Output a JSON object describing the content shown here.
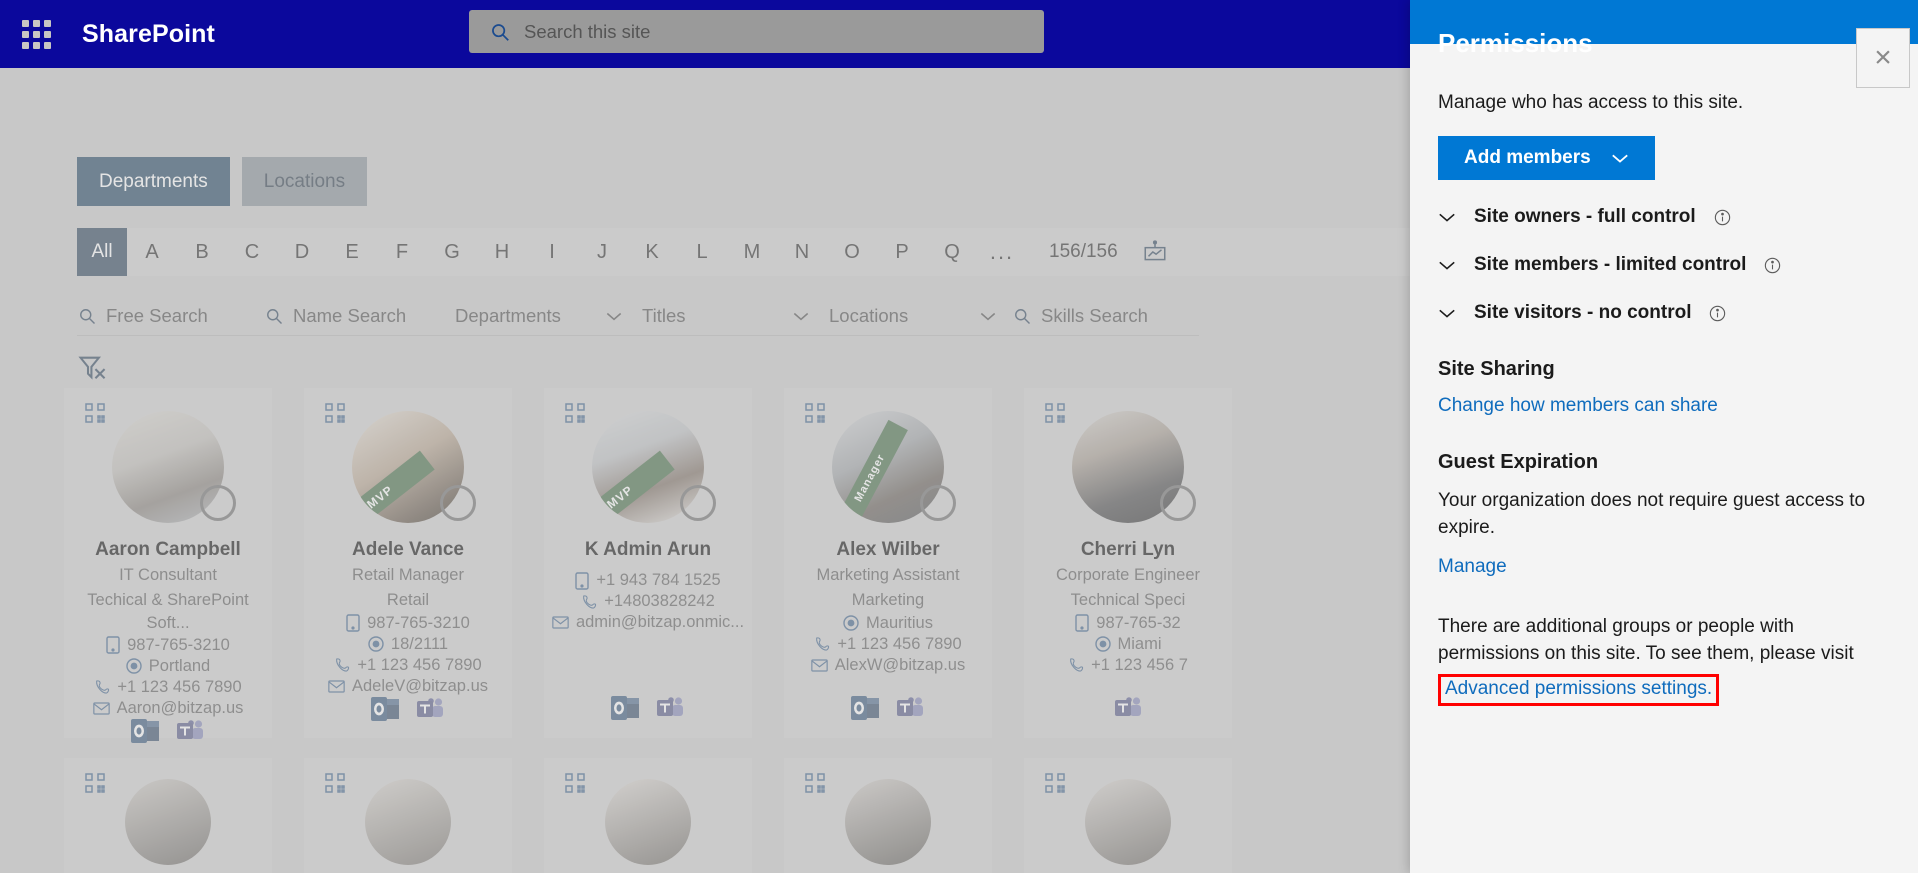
{
  "suite": {
    "waffle_icon": "app-launcher-waffle-icon",
    "brand": "SharePoint",
    "search": {
      "placeholder": "Search this site",
      "value": "",
      "icon": "search-icon"
    }
  },
  "page": {
    "tabs": [
      {
        "label": "Departments",
        "active": true
      },
      {
        "label": "Locations",
        "active": false
      }
    ],
    "alphabet": [
      "All",
      "A",
      "B",
      "C",
      "D",
      "E",
      "F",
      "G",
      "H",
      "I",
      "J",
      "K",
      "L",
      "M",
      "N",
      "O",
      "P",
      "Q",
      "..."
    ],
    "alphabet_active": "All",
    "count": "156/156",
    "presentation_icon": "presentation-chart-icon",
    "filters": [
      {
        "label": "Free Search",
        "type": "search",
        "icon": "search-icon"
      },
      {
        "label": "Name Search",
        "type": "search",
        "icon": "search-icon"
      },
      {
        "label": "Departments",
        "type": "dropdown",
        "icon": "chevron-down-icon"
      },
      {
        "label": "Titles",
        "type": "dropdown",
        "icon": "chevron-down-icon"
      },
      {
        "label": "Locations",
        "type": "dropdown",
        "icon": "chevron-down-icon"
      },
      {
        "label": "Skills Search",
        "type": "search",
        "icon": "search-icon"
      }
    ],
    "clear_filter_icon": "funnel-clear-icon",
    "people": [
      {
        "name": "Aaron Campbell",
        "title": "IT Consultant",
        "department": "Techical & SharePoint Soft...",
        "mobile": "987-765-3210",
        "location": "Portland",
        "phone": "+1 123 456 7890",
        "email": "Aaron@bitzap.us",
        "badge": "",
        "apps": [
          "outlook-icon",
          "teams-icon"
        ]
      },
      {
        "name": "Adele Vance",
        "title": "Retail Manager",
        "department": "Retail",
        "mobile": "987-765-3210",
        "location": "18/2111",
        "phone": "+1 123 456 7890",
        "email": "AdeleV@bitzap.us",
        "badge": "MVP",
        "apps": [
          "outlook-icon",
          "teams-icon"
        ]
      },
      {
        "name": "K Admin Arun",
        "title": "",
        "department": "",
        "mobile": "+1 943 784 1525",
        "location": "",
        "phone": "+14803828242",
        "email": "admin@bitzap.onmic...",
        "badge": "MVP",
        "apps": [
          "outlook-icon",
          "teams-icon"
        ]
      },
      {
        "name": "Alex Wilber",
        "title": "Marketing Assistant",
        "department": "Marketing",
        "mobile": "",
        "location": "Mauritius",
        "phone": "+1 123 456 7890",
        "email": "AlexW@bitzap.us",
        "badge": "Manager",
        "apps": [
          "outlook-icon",
          "teams-icon"
        ]
      },
      {
        "name": "Cherri Lyn",
        "title": "Corporate Engineer",
        "department": "Technical Speci",
        "mobile": "987-765-32",
        "location": "Miami",
        "phone": "+1 123 456 7",
        "email": "",
        "badge": "",
        "apps": [
          "teams-icon"
        ]
      }
    ]
  },
  "panel": {
    "title": "Permissions",
    "close_label": "×",
    "subtitle": "Manage who has access to this site.",
    "add_members_label": "Add members",
    "add_members_chevron": "chevron-down-icon",
    "groups": [
      {
        "label": "Site owners - full control",
        "info_icon": "info-icon",
        "chevron": "chevron-down-icon"
      },
      {
        "label": "Site members - limited control",
        "info_icon": "info-icon",
        "chevron": "chevron-down-icon"
      },
      {
        "label": "Site visitors - no control",
        "info_icon": "info-icon",
        "chevron": "chevron-down-icon"
      }
    ],
    "site_sharing_heading": "Site Sharing",
    "site_sharing_link": "Change how members can share",
    "guest_expiration_heading": "Guest Expiration",
    "guest_expiration_text": "Your organization does not require guest access to expire.",
    "guest_manage_link": "Manage",
    "additional_text": "There are additional groups or people with permissions on this site. To see them, please visit",
    "advanced_link": "Advanced permissions settings.",
    "highlight_color": "#ff0000",
    "accent_color": "#0078d4",
    "link_color": "#0f6cbd"
  }
}
